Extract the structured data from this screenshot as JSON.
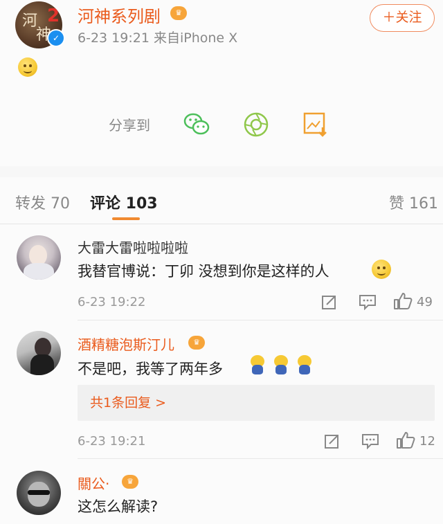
{
  "post": {
    "account_name": "河神系列剧",
    "vip_badge": "♛",
    "verified_mark": "✓",
    "meta": "6-23 19:21  来自iPhone X",
    "follow_label": "＋关注",
    "share_label": "分享到",
    "avatar_glyphs": [
      "河",
      "神",
      "2"
    ]
  },
  "tabs": {
    "repost": "转发 70",
    "comments": "评论 103",
    "likes": "赞 161"
  },
  "comments": [
    {
      "name": "大雷大雷啦啦啦啦",
      "text": "我替官博说：丁卯  没想到你是这样的人",
      "time": "6-23 19:22",
      "likes": "49"
    },
    {
      "name": "酒精糖泡斯汀儿",
      "text": "不是吧，我等了两年多",
      "reply_link": "共1条回复 >",
      "time": "6-23 19:21",
      "likes": "12"
    },
    {
      "name": "關公·",
      "text": "这怎么解读?"
    }
  ],
  "colors": {
    "accent": "#ea5b1d",
    "tab_underline": "#f08a30",
    "wechat_green": "#4cbf5a",
    "moments_green": "#8fc74a",
    "image_orange": "#f0a030"
  },
  "icons": {
    "share": [
      "wechat-icon",
      "moments-icon",
      "save-image-icon"
    ],
    "actions": [
      "repost-icon",
      "reply-icon",
      "like-icon"
    ]
  }
}
